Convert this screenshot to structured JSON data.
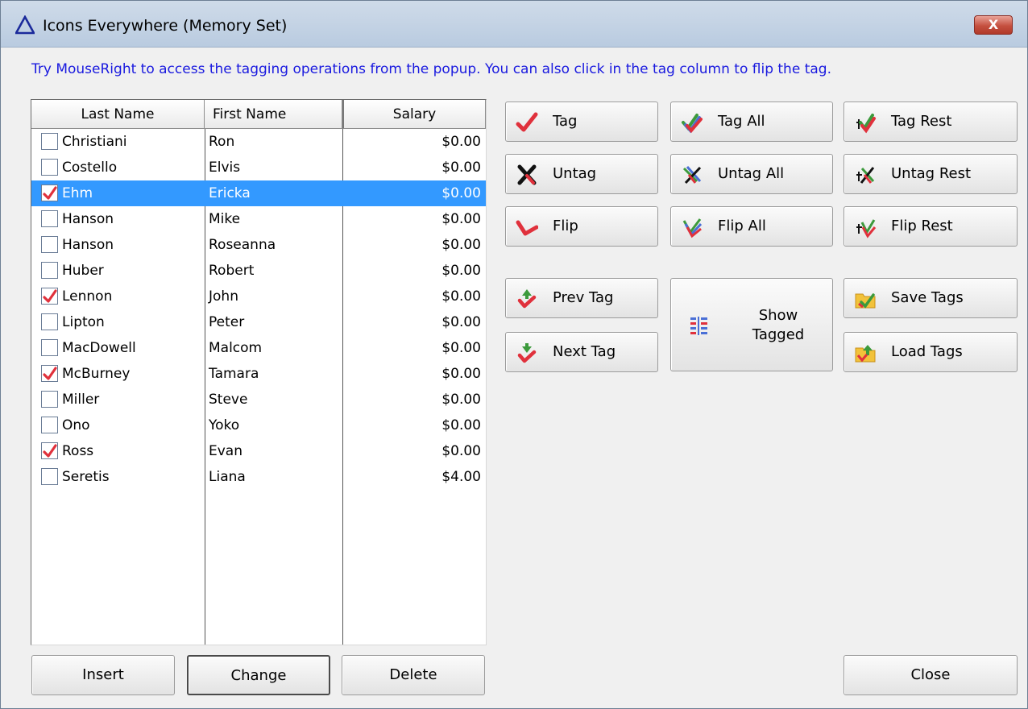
{
  "window": {
    "title": "Icons Everywhere (Memory Set)",
    "close_label": "X"
  },
  "hint": "Try MouseRight to access the tagging operations from the popup.  You can also click in the tag column to flip the tag.",
  "grid": {
    "headers": [
      "Last Name",
      "First Name",
      "Salary"
    ],
    "selected_index": 2,
    "rows": [
      {
        "tagged": false,
        "last": "Christiani",
        "first": "Ron",
        "salary": "$0.00"
      },
      {
        "tagged": false,
        "last": "Costello",
        "first": "Elvis",
        "salary": "$0.00"
      },
      {
        "tagged": true,
        "last": "Ehm",
        "first": "Ericka",
        "salary": "$0.00"
      },
      {
        "tagged": false,
        "last": "Hanson",
        "first": "Mike",
        "salary": "$0.00"
      },
      {
        "tagged": false,
        "last": "Hanson",
        "first": "Roseanna",
        "salary": "$0.00"
      },
      {
        "tagged": false,
        "last": "Huber",
        "first": "Robert",
        "salary": "$0.00"
      },
      {
        "tagged": true,
        "last": "Lennon",
        "first": "John",
        "salary": "$0.00"
      },
      {
        "tagged": false,
        "last": "Lipton",
        "first": "Peter",
        "salary": "$0.00"
      },
      {
        "tagged": false,
        "last": "MacDowell",
        "first": "Malcom",
        "salary": "$0.00"
      },
      {
        "tagged": true,
        "last": "McBurney",
        "first": "Tamara",
        "salary": "$0.00"
      },
      {
        "tagged": false,
        "last": "Miller",
        "first": "Steve",
        "salary": "$0.00"
      },
      {
        "tagged": false,
        "last": "Ono",
        "first": "Yoko",
        "salary": "$0.00"
      },
      {
        "tagged": true,
        "last": "Ross",
        "first": "Evan",
        "salary": "$0.00"
      },
      {
        "tagged": false,
        "last": "Seretis",
        "first": "Liana",
        "salary": "$4.00"
      }
    ]
  },
  "buttons": {
    "tag": "Tag",
    "tag_all": "Tag All",
    "tag_rest": "Tag Rest",
    "untag": "Untag",
    "untag_all": "Untag All",
    "untag_rest": "Untag Rest",
    "flip": "Flip",
    "flip_all": "Flip All",
    "flip_rest": "Flip Rest",
    "prev_tag": "Prev Tag",
    "next_tag": "Next Tag",
    "show_tagged_line1": "Show",
    "show_tagged_line2": "Tagged",
    "save_tags": "Save Tags",
    "load_tags": "Load Tags",
    "insert": "Insert",
    "change": "Change",
    "delete": "Delete",
    "close": "Close"
  },
  "icons": {
    "app": "triangle-icon",
    "tag": "check-icon",
    "untag": "x-icon",
    "flip": "flip-icon",
    "tag_all": "multi-check-icon",
    "untag_all": "multi-x-icon",
    "flip_all": "multi-flip-icon",
    "tag_rest": "rest-check-icon",
    "untag_rest": "rest-x-icon",
    "flip_rest": "rest-flip-icon",
    "prev_tag": "up-check-icon",
    "next_tag": "down-check-icon",
    "show_tagged": "list-icon",
    "save_tags": "folder-save-icon",
    "load_tags": "folder-load-icon"
  },
  "colors": {
    "selection": "#3399ff",
    "hint_text": "#1a1adf",
    "check_red": "#e0313c"
  }
}
